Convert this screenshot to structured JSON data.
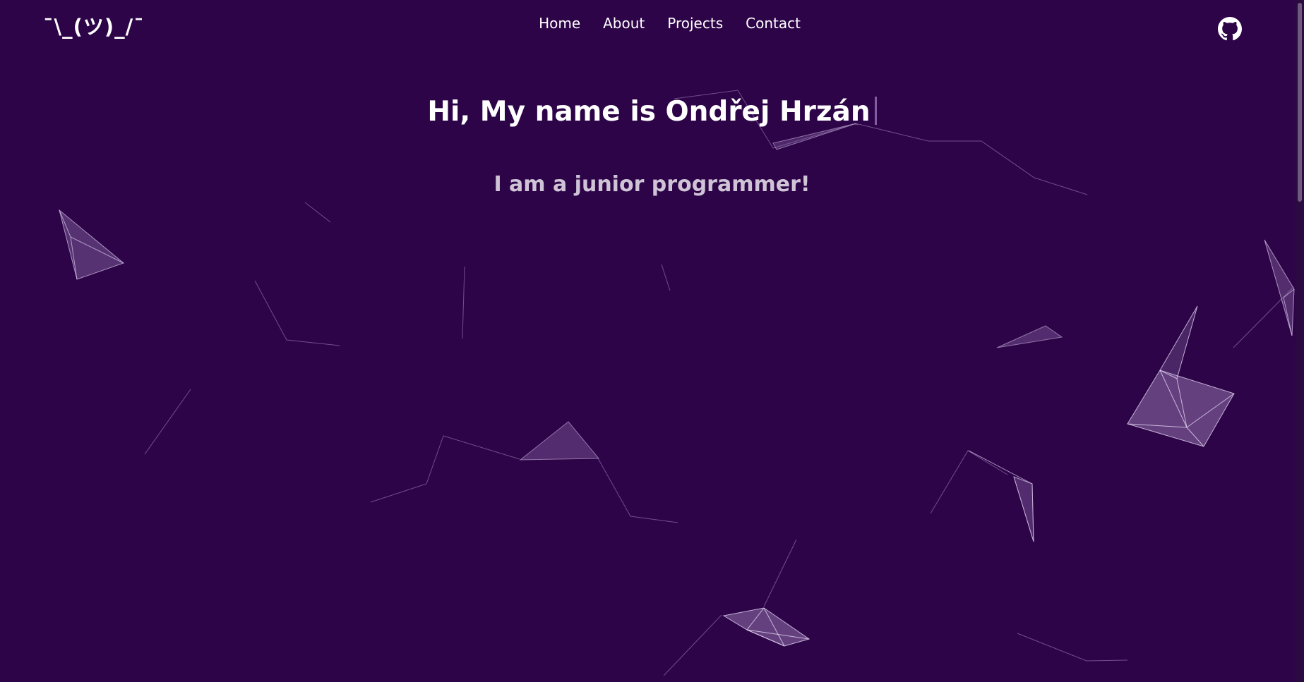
{
  "logo": {
    "text": "¯\\_(ツ)_/¯"
  },
  "nav": {
    "items": [
      {
        "label": "Home"
      },
      {
        "label": "About"
      },
      {
        "label": "Projects"
      },
      {
        "label": "Contact"
      }
    ]
  },
  "header": {
    "github_icon": "github-icon"
  },
  "hero": {
    "title": "Hi, My name is Ondřej Hrzán",
    "subtitle": "I am a junior programmer!"
  },
  "colors": {
    "background": "#2d0448",
    "text": "#ffffff",
    "subtitle": "#cfc3d6",
    "particle": "#a98ac4"
  }
}
